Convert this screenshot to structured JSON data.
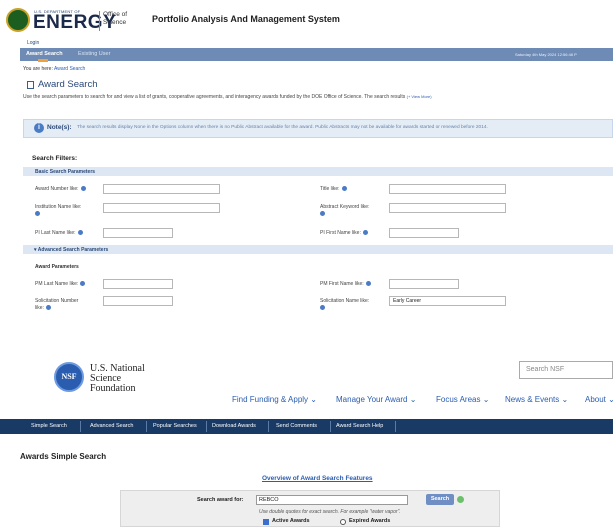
{
  "doe": {
    "logo_dept": "U.S. DEPARTMENT OF",
    "logo_energy": "ENERGY",
    "office_line1": "Office of",
    "office_line2": "Science",
    "system_title": "Portfolio Analysis And Management System",
    "login_tab": "Login",
    "tabs": [
      "Award Search",
      "Existing User"
    ],
    "date": "Saturday 4th May 2024 12:56:46 P",
    "breadcrumb_prefix": "You are here:",
    "breadcrumb_link": "Award Search",
    "page_title": "Award Search",
    "description": "Use the search parameters to search for and view a list of grants, cooperative agreements, and interagency awards funded by the DOE Office of Science. The search results",
    "view_more": "(+ View More)",
    "note_label": "Note(s):",
    "note_text": "The search results display None in the Options column when there is no Public Abstract available for the award. Public Abstracts may not be available for awards started or renewed before 2014.",
    "filters_heading": "Search Filters:",
    "basic_section": "Basic Search Parameters",
    "fields": {
      "award_number": "Award Number like:",
      "title": "Title like:",
      "institution": "Institution Name like:",
      "abstract": "Abstract Keyword like:",
      "pi_last": "PI Last Name like:",
      "pi_first": "PI First Name like:",
      "pm_last": "PM Last Name like:",
      "pm_first": "PM First Name like:",
      "solicitation_number": "Solicitation Number like:",
      "solicitation_name": "Solicitation Name like:"
    },
    "advanced_section": "Advanced Search Parameters",
    "award_params": "Award Parameters",
    "solicitation_name_value": "Early Career"
  },
  "nsf": {
    "name_line1": "U.S. National",
    "name_line2": "Science",
    "name_line3": "Foundation",
    "logo_text": "NSF",
    "search_placeholder": "Search NSF",
    "nav": [
      "Find Funding & Apply",
      "Manage Your Award",
      "Focus Areas",
      "News & Events",
      "About"
    ],
    "bar": [
      "Simple Search",
      "Advanced Search",
      "Popular Searches",
      "Download Awards",
      "Send Comments",
      "Award Search Help"
    ],
    "heading": "Awards Simple Search",
    "overview_link": "Overview of Award Search Features",
    "search_label": "Search award for:",
    "search_value": "REBCO",
    "search_button": "Search",
    "hint": "Use double quotes for exact search. For example \"water vapor\".",
    "active_awards": "Active Awards",
    "expired_awards": "Expired Awards",
    "active_checked": true,
    "expired_checked": false
  },
  "colors": {
    "doe_nav": "#6d8bb5",
    "doe_tab_accent": "#f2a03d",
    "nsf_bar": "#1a3a66",
    "link": "#2a5db0"
  }
}
